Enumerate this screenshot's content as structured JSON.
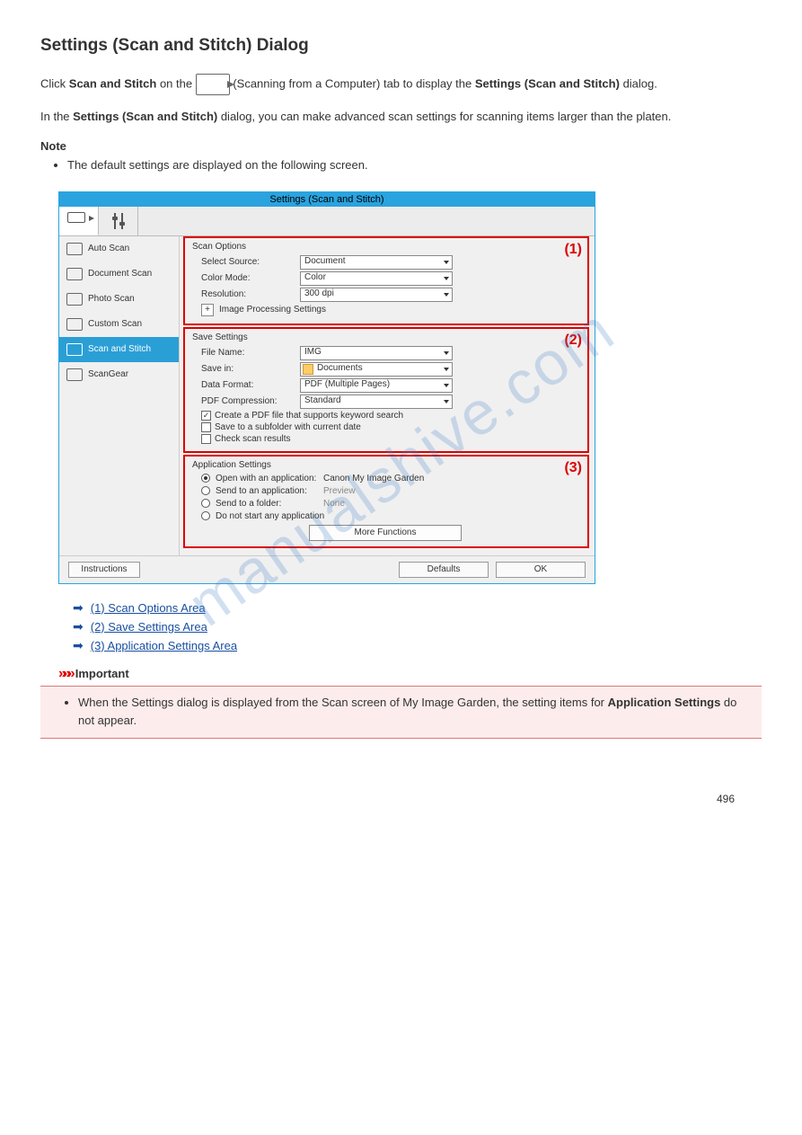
{
  "page": {
    "title": "Settings (Scan and Stitch) Dialog",
    "intro_part1": "Click ",
    "intro_bold1": "Scan and Stitch",
    "intro_part2": " on the ",
    "intro_part3": " (Scanning from a Computer) tab to display the ",
    "intro_bold2": "Settings (Scan and Stitch)",
    "intro_part4": " dialog.",
    "paragraph2": "In the Settings (Scan and Stitch) dialog, you can make advanced scan settings for scanning items larger than the platen.",
    "note_label": "Note",
    "note_item": "The default settings are displayed on the following screen.",
    "page_number": "496"
  },
  "dialog": {
    "title": "Settings (Scan and Stitch)",
    "sidebar": {
      "items": [
        {
          "label": "Auto Scan"
        },
        {
          "label": "Document Scan"
        },
        {
          "label": "Photo Scan"
        },
        {
          "label": "Custom Scan"
        },
        {
          "label": "Scan and Stitch"
        },
        {
          "label": "ScanGear"
        }
      ]
    },
    "section1": {
      "header": "Scan Options",
      "callout": "(1)",
      "select_source_label": "Select Source:",
      "select_source_value": "Document",
      "color_mode_label": "Color Mode:",
      "color_mode_value": "Color",
      "resolution_label": "Resolution:",
      "resolution_value": "300 dpi",
      "img_proc_label": "Image Processing Settings"
    },
    "section2": {
      "header": "Save Settings",
      "callout": "(2)",
      "file_name_label": "File Name:",
      "file_name_value": "IMG",
      "save_in_label": "Save in:",
      "save_in_value": "Documents",
      "data_format_label": "Data Format:",
      "data_format_value": "PDF (Multiple Pages)",
      "pdf_comp_label": "PDF Compression:",
      "pdf_comp_value": "Standard",
      "chk_keyword": "Create a PDF file that supports keyword search",
      "chk_subfolder": "Save to a subfolder with current date",
      "chk_check_results": "Check scan results"
    },
    "section3": {
      "header": "Application Settings",
      "callout": "(3)",
      "open_app_label": "Open with an application:",
      "open_app_value": "Canon My Image Garden",
      "send_app_label": "Send to an application:",
      "send_app_value": "Preview",
      "send_folder_label": "Send to a folder:",
      "send_folder_value": "None",
      "no_app_label": "Do not start any application",
      "more_functions": "More Functions"
    },
    "buttons": {
      "instructions": "Instructions",
      "defaults": "Defaults",
      "ok": "OK"
    }
  },
  "links": {
    "l1": "(1) Scan Options Area",
    "l2": "(2) Save Settings Area",
    "l3": "(3) Application Settings Area"
  },
  "important": {
    "label": "Important",
    "item": "When the Settings dialog is displayed from the Scan screen of My Image Garden, the setting items for Application Settings do not appear."
  },
  "watermark": "manualshive.com"
}
